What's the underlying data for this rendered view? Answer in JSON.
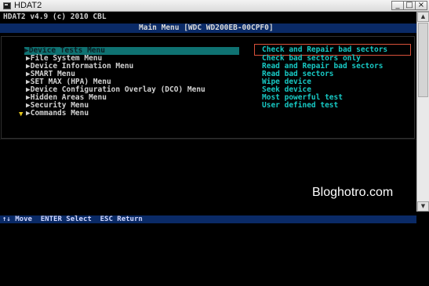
{
  "window": {
    "title": "HDAT2",
    "minimize": "_",
    "maximize": "□",
    "close": "×"
  },
  "console": {
    "header": "HDAT2 v4.9 (c) 2010 CBL",
    "main_title": "Main Menu [WDC WD200EB-00CPF0]",
    "menu": [
      "▶Device Tests Menu",
      "▶File System Menu",
      "▶Device Information Menu",
      "▶SMART Menu",
      "▶SET MAX (HPA) Menu",
      "▶Device Configuration Overlay (DCO) Menu",
      "▶Hidden Areas Menu",
      "▶Security Menu",
      "▶Commands Menu"
    ],
    "more_arrow": "▼",
    "submenu": [
      "Check and Repair bad sectors",
      "Check bad sectors only",
      "Read and Repair bad sectors",
      "Read bad sectors",
      "Wipe device",
      "Seek device",
      "Most powerful test",
      "User defined test"
    ],
    "status": "↑↓ Move  ENTER Select  ESC Return"
  },
  "scrollbar": {
    "up": "▲",
    "down": "▼"
  },
  "watermark": "Bloghotro.com",
  "colors": {
    "selection": "#0f7272",
    "submenu_text": "#17c9c4",
    "highlight_box": "#d8503a",
    "title_bar": "#0a2a66",
    "arrow": "#e3c51d"
  }
}
